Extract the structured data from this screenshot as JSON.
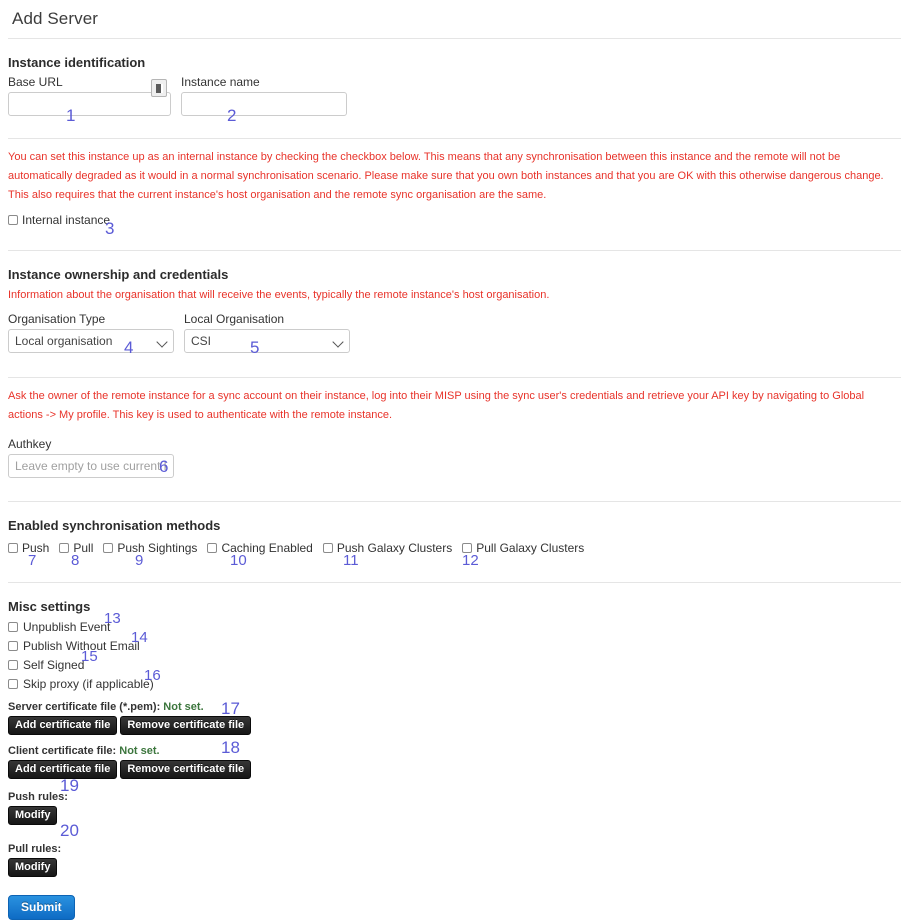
{
  "page": {
    "title": "Add Server",
    "submit_label": "Submit"
  },
  "sections": {
    "identification": {
      "title": "Instance identification",
      "base_url_label": "Base URL",
      "base_url_value": "",
      "base_url_placeholder": "",
      "instance_name_label": "Instance name",
      "instance_name_value": "",
      "instance_name_placeholder": "",
      "internal_note": "You can set this instance up as an internal instance by checking the checkbox below. This means that any synchronisation between this instance and the remote will not be automatically degraded as it would in a normal synchronisation scenario. Please make sure that you own both instances and that you are OK with this otherwise dangerous change. This also requires that the current instance's host organisation and the remote sync organisation are the same.",
      "internal_instance_label": "Internal instance"
    },
    "ownership": {
      "title": "Instance ownership and credentials",
      "note": "Information about the organisation that will receive the events, typically the remote instance's host organisation.",
      "org_type_label": "Organisation Type",
      "org_type_value": "Local organisation",
      "local_org_label": "Local Organisation",
      "local_org_value": "CSI",
      "authkey_note": "Ask the owner of the remote instance for a sync account on their instance, log into their MISP using the sync user's credentials and retrieve your API key by navigating to Global actions -> My profile. This key is used to authenticate with the remote instance.",
      "authkey_label": "Authkey",
      "authkey_value": "",
      "authkey_placeholder": "Leave empty to use current key"
    },
    "sync_methods": {
      "title": "Enabled synchronisation methods",
      "items": [
        {
          "label": "Push"
        },
        {
          "label": "Pull"
        },
        {
          "label": "Push Sightings"
        },
        {
          "label": "Caching Enabled"
        },
        {
          "label": "Push Galaxy Clusters"
        },
        {
          "label": "Pull Galaxy Clusters"
        }
      ]
    },
    "misc": {
      "title": "Misc settings",
      "items": [
        {
          "label": "Unpublish Event"
        },
        {
          "label": "Publish Without Email"
        },
        {
          "label": "Self Signed"
        },
        {
          "label": "Skip proxy (if applicable)"
        }
      ],
      "server_cert_label": "Server certificate file (*.pem):",
      "server_cert_status": "Not set.",
      "client_cert_label": "Client certificate file:",
      "client_cert_status": "Not set.",
      "add_cert_label": "Add certificate file",
      "remove_cert_label": "Remove certificate file",
      "push_rules_label": "Push rules:",
      "pull_rules_label": "Pull rules:",
      "modify_label": "Modify"
    }
  },
  "annotations": [
    {
      "n": "1"
    },
    {
      "n": "2"
    },
    {
      "n": "3"
    },
    {
      "n": "4"
    },
    {
      "n": "5"
    },
    {
      "n": "6"
    },
    {
      "n": "7"
    },
    {
      "n": "8"
    },
    {
      "n": "9"
    },
    {
      "n": "10"
    },
    {
      "n": "11"
    },
    {
      "n": "12"
    },
    {
      "n": "13"
    },
    {
      "n": "14"
    },
    {
      "n": "15"
    },
    {
      "n": "16"
    },
    {
      "n": "17"
    },
    {
      "n": "18"
    },
    {
      "n": "19"
    },
    {
      "n": "20"
    }
  ],
  "colors": {
    "annotation": "#5b5bd6",
    "warning_text": "#e8332a",
    "status_ok": "#3c763d",
    "submit_button": "#1b7ad0"
  }
}
